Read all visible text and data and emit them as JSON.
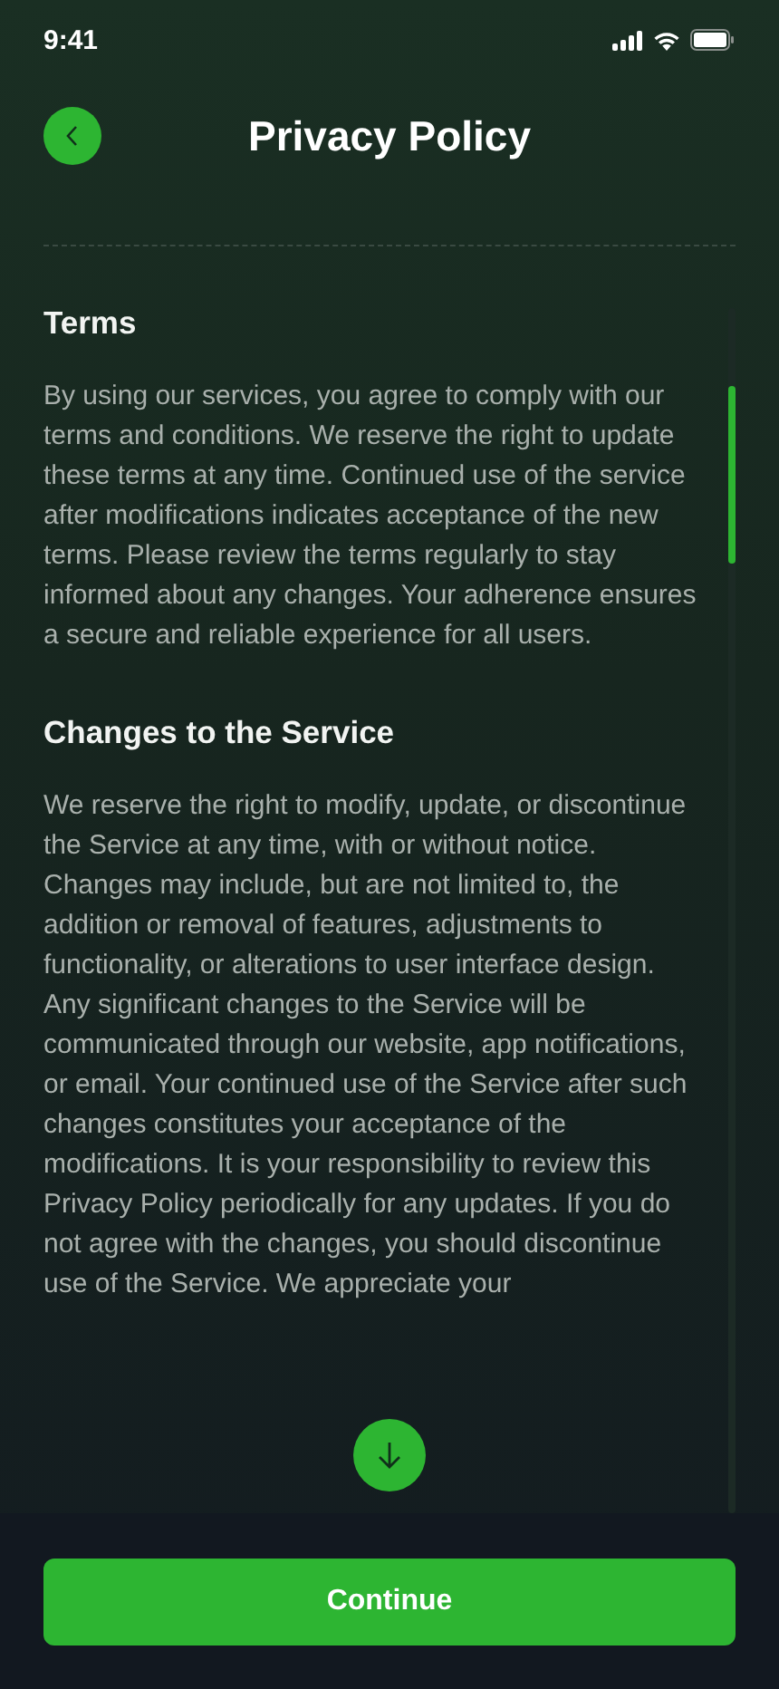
{
  "status_bar": {
    "time": "9:41"
  },
  "header": {
    "title": "Privacy Policy"
  },
  "sections": [
    {
      "heading": "Terms",
      "body": "By using our services, you agree to comply with our terms and conditions. We reserve the right to update these terms at any time. Continued use of the service after modifications indicates acceptance of the new terms. Please review the terms regularly to stay informed about any changes. Your adherence ensures a secure and reliable experience for all users."
    },
    {
      "heading": "Changes to the Service",
      "body": "We reserve the right to modify, update, or discontinue the Service at any time, with or without notice. Changes may include, but are not limited to, the addition or removal of features, adjustments to functionality, or alterations to user interface design. Any significant changes to the Service will be communicated through our website, app notifications, or email. Your continued use of the Service after such changes constitutes your acceptance of the modifications. It is your responsibility to review this Privacy Policy periodically for any updates. If you do not agree with the changes, you should discontinue use of the Service. We appreciate your"
    }
  ],
  "primary_button": {
    "label": "Continue"
  }
}
